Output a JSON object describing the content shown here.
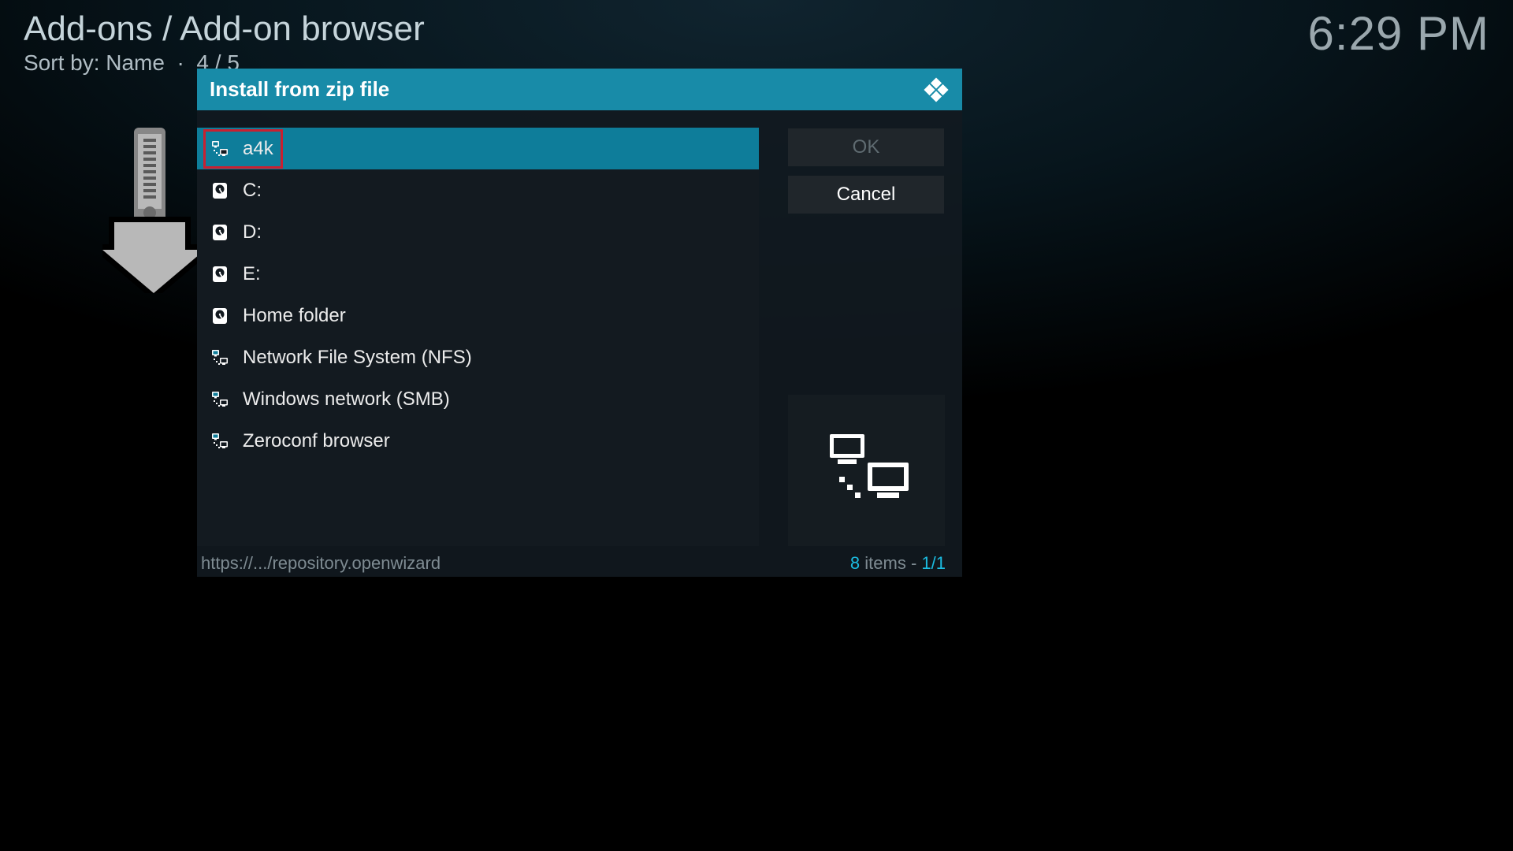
{
  "header": {
    "breadcrumb": "Add-ons / Add-on browser",
    "sort_label": "Sort by: Name",
    "position": "4 / 5"
  },
  "clock": "6:29 PM",
  "dialog": {
    "title": "Install from zip file",
    "ok_label": "OK",
    "cancel_label": "Cancel",
    "footer_path": "https://.../repository.openwizard",
    "footer_count_num": "8",
    "footer_count_items": " items - ",
    "footer_count_page": "1/1",
    "items": [
      {
        "label": "a4k",
        "icon": "network",
        "selected": true
      },
      {
        "label": "C:",
        "icon": "drive",
        "selected": false
      },
      {
        "label": "D:",
        "icon": "drive",
        "selected": false
      },
      {
        "label": "E:",
        "icon": "drive",
        "selected": false
      },
      {
        "label": "Home folder",
        "icon": "drive",
        "selected": false
      },
      {
        "label": "Network File System (NFS)",
        "icon": "network",
        "selected": false
      },
      {
        "label": "Windows network (SMB)",
        "icon": "network",
        "selected": false
      },
      {
        "label": "Zeroconf browser",
        "icon": "network",
        "selected": false
      }
    ]
  }
}
